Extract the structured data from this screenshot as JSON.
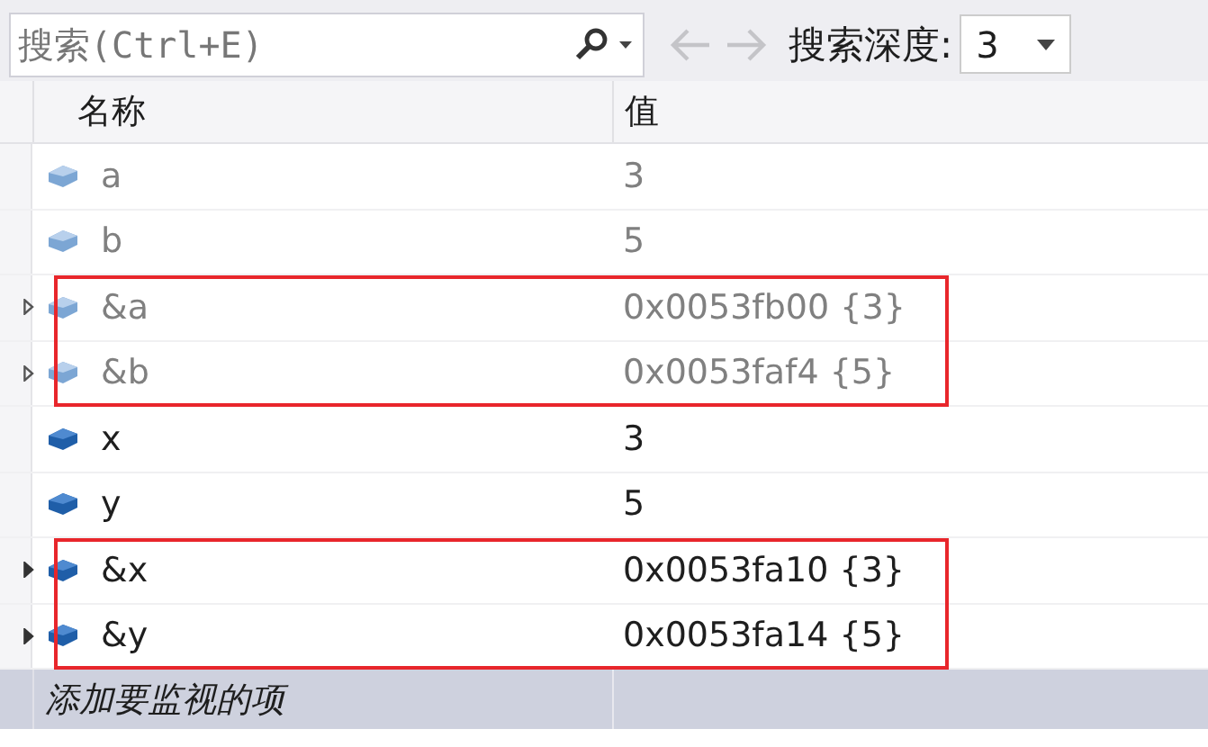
{
  "toolbar": {
    "search": {
      "placeholder": "搜索(Ctrl+E)"
    },
    "back_enabled": false,
    "forward_enabled": false,
    "depth_label": "搜索深度:",
    "depth_value": "3"
  },
  "table": {
    "columns": [
      "名称",
      "值"
    ],
    "groups": [
      {
        "outlined": false,
        "rows": [
          {
            "name": "a",
            "value": "3",
            "stale": true,
            "expandable": false
          },
          {
            "name": "b",
            "value": "5",
            "stale": true,
            "expandable": false
          }
        ]
      },
      {
        "outlined": true,
        "rows": [
          {
            "name": "&a",
            "value": "0x0053fb00 {3}",
            "stale": true,
            "expandable": true
          },
          {
            "name": "&b",
            "value": "0x0053faf4 {5}",
            "stale": true,
            "expandable": true
          }
        ]
      },
      {
        "outlined": false,
        "rows": [
          {
            "name": "x",
            "value": "3",
            "stale": false,
            "expandable": false
          },
          {
            "name": "y",
            "value": "5",
            "stale": false,
            "expandable": false
          }
        ]
      },
      {
        "outlined": true,
        "rows": [
          {
            "name": "&x",
            "value": "0x0053fa10 {3}",
            "stale": false,
            "expandable": true
          },
          {
            "name": "&y",
            "value": "0x0053fa14 {5}",
            "stale": false,
            "expandable": true
          }
        ]
      }
    ],
    "add_item_placeholder": "添加要监视的项"
  }
}
